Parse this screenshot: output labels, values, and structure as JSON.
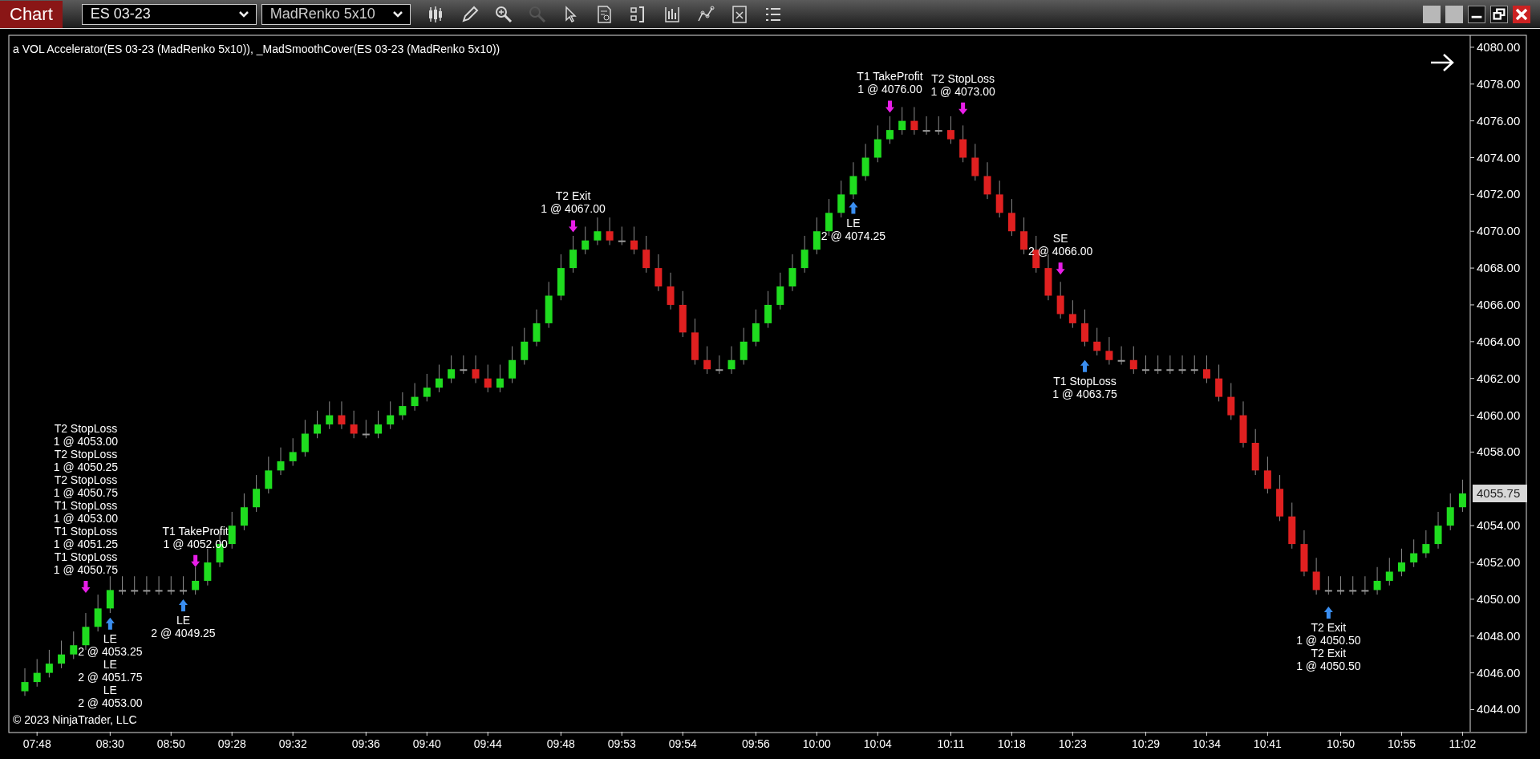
{
  "window": {
    "title": "Chart",
    "controls": [
      {
        "kind": "blank"
      },
      {
        "kind": "blank"
      },
      {
        "kind": "minimize"
      },
      {
        "kind": "restore"
      },
      {
        "kind": "close"
      }
    ]
  },
  "toolbar": {
    "instrument": "ES 03-23",
    "bar_type": "MadRenko 5x10",
    "tools": [
      {
        "kind": "bar-style",
        "disabled": false
      },
      {
        "kind": "draw",
        "disabled": false
      },
      {
        "kind": "zoom-in",
        "disabled": false
      },
      {
        "kind": "zoom-out",
        "disabled": true
      },
      {
        "kind": "pointer",
        "disabled": false
      },
      {
        "kind": "data-box",
        "disabled": false
      },
      {
        "kind": "panels",
        "disabled": false
      },
      {
        "kind": "indicators",
        "disabled": false
      },
      {
        "kind": "strategies",
        "disabled": false
      },
      {
        "kind": "templates",
        "disabled": false
      },
      {
        "kind": "list",
        "disabled": false
      }
    ]
  },
  "chart": {
    "indicator_label": "a VOL Accelerator(ES 03-23 (MadRenko 5x10)), _MadSmoothCover(ES 03-23 (MadRenko 5x10))",
    "copyright": "© 2023 NinjaTrader, LLC",
    "last_price": "4055.75",
    "chart_data": {
      "type": "candlestick",
      "ylim": [
        4042.8,
        4080.65
      ],
      "yticks": [
        {
          "value": 4044,
          "label": "4044.00"
        },
        {
          "value": 4046,
          "label": "4046.00"
        },
        {
          "value": 4048,
          "label": "4048.00"
        },
        {
          "value": 4050,
          "label": "4050.00"
        },
        {
          "value": 4052,
          "label": "4052.00"
        },
        {
          "value": 4054,
          "label": "4054.00"
        },
        {
          "value": 4058,
          "label": "4058.00"
        },
        {
          "value": 4060,
          "label": "4060.00"
        },
        {
          "value": 4062,
          "label": "4062.00"
        },
        {
          "value": 4064,
          "label": "4064.00"
        },
        {
          "value": 4066,
          "label": "4066.00"
        },
        {
          "value": 4068,
          "label": "4068.00"
        },
        {
          "value": 4070,
          "label": "4070.00"
        },
        {
          "value": 4072,
          "label": "4072.00"
        },
        {
          "value": 4074,
          "label": "4074.00"
        },
        {
          "value": 4076,
          "label": "4076.00"
        },
        {
          "value": 4078,
          "label": "4078.00"
        },
        {
          "value": 4080,
          "label": "4080.00"
        }
      ],
      "categories": [
        null,
        "07:48",
        null,
        null,
        null,
        null,
        null,
        "08:30",
        null,
        null,
        null,
        null,
        "08:50",
        null,
        null,
        null,
        null,
        "09:28",
        null,
        null,
        null,
        null,
        "09:32",
        null,
        null,
        null,
        null,
        null,
        "09:36",
        null,
        null,
        null,
        null,
        "09:40",
        null,
        null,
        null,
        null,
        "09:44",
        null,
        null,
        null,
        null,
        null,
        "09:48",
        null,
        null,
        null,
        null,
        "09:53",
        null,
        null,
        null,
        null,
        "09:54",
        null,
        null,
        null,
        null,
        null,
        "09:56",
        null,
        null,
        null,
        null,
        "10:00",
        null,
        null,
        null,
        null,
        "10:04",
        null,
        null,
        null,
        null,
        null,
        "10:11",
        null,
        null,
        null,
        null,
        "10:18",
        null,
        null,
        null,
        null,
        "10:23",
        null,
        null,
        null,
        null,
        null,
        "10:29",
        null,
        null,
        null,
        null,
        "10:34",
        null,
        null,
        null,
        null,
        "10:41",
        null,
        null,
        null,
        null,
        null,
        "10:50",
        null,
        null,
        null,
        null,
        "10:55",
        null,
        null,
        null,
        null,
        "11:02"
      ],
      "ohlc": [
        [
          4045,
          4046.25,
          4044.75,
          4045.5
        ],
        [
          4045.5,
          4046.75,
          4045.25,
          4046
        ],
        [
          4046,
          4047.25,
          4045.75,
          4046.5
        ],
        [
          4046.5,
          4047.75,
          4046.25,
          4047
        ],
        [
          4047,
          4048.25,
          4046.75,
          4047.5
        ],
        [
          4047.5,
          4049.25,
          4047.25,
          4048.5
        ],
        [
          4048.5,
          4050.25,
          4048.25,
          4049.5
        ],
        [
          4049.5,
          4051.25,
          4049.25,
          4050.5
        ],
        [
          4050.5,
          4051.25,
          4050.25,
          4050.5
        ],
        [
          4050.5,
          4051.25,
          4050.25,
          4050.5
        ],
        [
          4050.5,
          4051.25,
          4050.25,
          4050.5
        ],
        [
          4050.5,
          4051.25,
          4050.25,
          4050.5
        ],
        [
          4050.5,
          4051.25,
          4050.25,
          4050.5
        ],
        [
          4050.5,
          4051.25,
          4050.25,
          4050.5
        ],
        [
          4050.5,
          4051.75,
          4050.25,
          4051
        ],
        [
          4051,
          4052.75,
          4050.75,
          4052
        ],
        [
          4052,
          4053.75,
          4051.75,
          4053
        ],
        [
          4053,
          4054.75,
          4052.75,
          4054
        ],
        [
          4054,
          4055.75,
          4053.75,
          4055
        ],
        [
          4055,
          4056.75,
          4054.75,
          4056
        ],
        [
          4056,
          4057.75,
          4055.75,
          4057
        ],
        [
          4057,
          4058.25,
          4056.75,
          4057.5
        ],
        [
          4057.5,
          4058.75,
          4057.25,
          4058
        ],
        [
          4058,
          4059.75,
          4057.75,
          4059
        ],
        [
          4059,
          4060.25,
          4058.75,
          4059.5
        ],
        [
          4059.5,
          4060.75,
          4059.25,
          4060
        ],
        [
          4060,
          4060.75,
          4059.25,
          4059.5
        ],
        [
          4059.5,
          4060.25,
          4058.75,
          4059
        ],
        [
          4059,
          4059.75,
          4058.75,
          4059
        ],
        [
          4059,
          4060.25,
          4058.75,
          4059.5
        ],
        [
          4059.5,
          4060.75,
          4059.25,
          4060
        ],
        [
          4060,
          4061.25,
          4059.75,
          4060.5
        ],
        [
          4060.5,
          4061.75,
          4060.25,
          4061
        ],
        [
          4061,
          4062.25,
          4060.75,
          4061.5
        ],
        [
          4061.5,
          4062.75,
          4061.25,
          4062
        ],
        [
          4062,
          4063.25,
          4061.75,
          4062.5
        ],
        [
          4062.5,
          4063.25,
          4062.25,
          4062.5
        ],
        [
          4062.5,
          4063.25,
          4061.75,
          4062
        ],
        [
          4062,
          4062.75,
          4061.25,
          4061.5
        ],
        [
          4061.5,
          4062.75,
          4061.25,
          4062
        ],
        [
          4062,
          4063.75,
          4061.75,
          4063
        ],
        [
          4063,
          4064.75,
          4062.75,
          4064
        ],
        [
          4064,
          4065.75,
          4063.75,
          4065
        ],
        [
          4065,
          4067.25,
          4064.75,
          4066.5
        ],
        [
          4066.5,
          4068.75,
          4066.25,
          4068
        ],
        [
          4068,
          4069.75,
          4067.75,
          4069
        ],
        [
          4069,
          4070.25,
          4068.75,
          4069.5
        ],
        [
          4069.5,
          4070.75,
          4069.25,
          4070
        ],
        [
          4070,
          4070.75,
          4069.25,
          4069.5
        ],
        [
          4069.5,
          4070.25,
          4069.25,
          4069.5
        ],
        [
          4069.5,
          4070.25,
          4068.75,
          4069
        ],
        [
          4069,
          4069.75,
          4067.75,
          4068
        ],
        [
          4068,
          4068.75,
          4066.75,
          4067
        ],
        [
          4067,
          4067.75,
          4065.75,
          4066
        ],
        [
          4066,
          4066.75,
          4064.25,
          4064.5
        ],
        [
          4064.5,
          4065.25,
          4062.75,
          4063
        ],
        [
          4063,
          4063.75,
          4062.25,
          4062.5
        ],
        [
          4062.5,
          4063.25,
          4062.25,
          4062.5
        ],
        [
          4062.5,
          4063.75,
          4062.25,
          4063
        ],
        [
          4063,
          4064.75,
          4062.75,
          4064
        ],
        [
          4064,
          4065.75,
          4063.75,
          4065
        ],
        [
          4065,
          4066.75,
          4064.75,
          4066
        ],
        [
          4066,
          4067.75,
          4065.75,
          4067
        ],
        [
          4067,
          4068.75,
          4066.75,
          4068
        ],
        [
          4068,
          4069.75,
          4067.75,
          4069
        ],
        [
          4069,
          4070.75,
          4068.75,
          4070
        ],
        [
          4070,
          4071.75,
          4069.75,
          4071
        ],
        [
          4071,
          4072.75,
          4070.75,
          4072
        ],
        [
          4072,
          4073.75,
          4071.75,
          4073
        ],
        [
          4073,
          4074.75,
          4072.75,
          4074
        ],
        [
          4074,
          4075.75,
          4073.75,
          4075
        ],
        [
          4075,
          4076.25,
          4074.75,
          4075.5
        ],
        [
          4075.5,
          4076.75,
          4075.25,
          4076
        ],
        [
          4076,
          4076.75,
          4075.25,
          4075.5
        ],
        [
          4075.5,
          4076.25,
          4075.25,
          4075.5
        ],
        [
          4075.5,
          4076.25,
          4075.25,
          4075.5
        ],
        [
          4075.5,
          4076.25,
          4074.75,
          4075
        ],
        [
          4075,
          4075.75,
          4073.75,
          4074
        ],
        [
          4074,
          4074.75,
          4072.75,
          4073
        ],
        [
          4073,
          4073.75,
          4071.75,
          4072
        ],
        [
          4072,
          4072.75,
          4070.75,
          4071
        ],
        [
          4071,
          4071.75,
          4069.75,
          4070
        ],
        [
          4070,
          4070.75,
          4068.75,
          4069
        ],
        [
          4069,
          4069.75,
          4067.75,
          4068
        ],
        [
          4068,
          4068.75,
          4066.25,
          4066.5
        ],
        [
          4066.5,
          4067.25,
          4065.25,
          4065.5
        ],
        [
          4065.5,
          4066.25,
          4064.75,
          4065
        ],
        [
          4065,
          4065.75,
          4063.75,
          4064
        ],
        [
          4064,
          4064.75,
          4063.25,
          4063.5
        ],
        [
          4063.5,
          4064.25,
          4062.75,
          4063
        ],
        [
          4063,
          4063.75,
          4062.75,
          4063
        ],
        [
          4063,
          4063.75,
          4062.25,
          4062.5
        ],
        [
          4062.5,
          4063.25,
          4062.25,
          4062.5
        ],
        [
          4062.5,
          4063.25,
          4062.25,
          4062.5
        ],
        [
          4062.5,
          4063.25,
          4062.25,
          4062.5
        ],
        [
          4062.5,
          4063.25,
          4062.25,
          4062.5
        ],
        [
          4062.5,
          4063.25,
          4062.25,
          4062.5
        ],
        [
          4062.5,
          4063.25,
          4061.75,
          4062
        ],
        [
          4062,
          4062.75,
          4060.75,
          4061
        ],
        [
          4061,
          4061.75,
          4059.75,
          4060
        ],
        [
          4060,
          4060.75,
          4058.25,
          4058.5
        ],
        [
          4058.5,
          4059.25,
          4056.75,
          4057
        ],
        [
          4057,
          4057.75,
          4055.75,
          4056
        ],
        [
          4056,
          4056.75,
          4054.25,
          4054.5
        ],
        [
          4054.5,
          4055.25,
          4052.75,
          4053
        ],
        [
          4053,
          4053.75,
          4051.25,
          4051.5
        ],
        [
          4051.5,
          4052.25,
          4050.25,
          4050.5
        ],
        [
          4050.5,
          4051.25,
          4050.25,
          4050.5
        ],
        [
          4050.5,
          4051.25,
          4050.25,
          4050.5
        ],
        [
          4050.5,
          4051.25,
          4050.25,
          4050.5
        ],
        [
          4050.5,
          4051.25,
          4050.25,
          4050.5
        ],
        [
          4050.5,
          4051.75,
          4050.25,
          4051
        ],
        [
          4051,
          4052.25,
          4050.75,
          4051.5
        ],
        [
          4051.5,
          4052.75,
          4051.25,
          4052
        ],
        [
          4052,
          4053.25,
          4051.75,
          4052.5
        ],
        [
          4052.5,
          4053.75,
          4052.25,
          4053
        ],
        [
          4053,
          4054.75,
          4052.75,
          4054
        ],
        [
          4054,
          4055.75,
          4053.75,
          4055
        ],
        [
          4055,
          4056.5,
          4054.75,
          4055.75
        ]
      ]
    },
    "trade_markers": [
      {
        "kind": "sell",
        "labels": [
          {
            "title": "T2 StopLoss",
            "detail": "1 @ 4053.00"
          },
          {
            "title": "T2 StopLoss",
            "detail": "1 @ 4050.25"
          },
          {
            "title": "T2 StopLoss",
            "detail": "1 @ 4050.75"
          },
          {
            "title": "T1 StopLoss",
            "detail": "1 @ 4053.00"
          },
          {
            "title": "T1 StopLoss",
            "detail": "1 @ 4051.25"
          },
          {
            "title": "T1 StopLoss",
            "detail": "1 @ 4050.75"
          }
        ]
      },
      {
        "kind": "sell",
        "labels": [
          {
            "title": "T1 TakeProfit",
            "detail": "1 @ 4052.00"
          }
        ]
      },
      {
        "kind": "buy",
        "labels": [
          {
            "title": "LE",
            "detail": "2 @ 4053.25"
          },
          {
            "title": "LE",
            "detail": "2 @ 4051.75"
          },
          {
            "title": "LE",
            "detail": "2 @ 4053.00"
          }
        ]
      },
      {
        "kind": "buy",
        "labels": [
          {
            "title": "LE",
            "detail": "2 @ 4049.25"
          }
        ]
      },
      {
        "kind": "sell",
        "labels": [
          {
            "title": "T2 Exit",
            "detail": "1 @ 4067.00"
          }
        ]
      },
      {
        "kind": "buy",
        "labels": [
          {
            "title": "LE",
            "detail": "2 @ 4074.25"
          }
        ]
      },
      {
        "kind": "sell",
        "labels": [
          {
            "title": "T1 TakeProfit",
            "detail": "1 @ 4076.00"
          }
        ]
      },
      {
        "kind": "sell",
        "labels": [
          {
            "title": "T2 StopLoss",
            "detail": "1 @ 4073.00"
          }
        ]
      },
      {
        "kind": "sell",
        "labels": [
          {
            "title": "SE",
            "detail": "2 @ 4066.00"
          }
        ]
      },
      {
        "kind": "buy",
        "labels": [
          {
            "title": "T1 StopLoss",
            "detail": "1 @ 4063.75"
          }
        ]
      },
      {
        "kind": "buy",
        "labels": [
          {
            "title": "T2 Exit",
            "detail": "1 @ 4050.50"
          },
          {
            "title": "T2 Exit",
            "detail": "1 @ 4050.50"
          }
        ]
      }
    ]
  }
}
